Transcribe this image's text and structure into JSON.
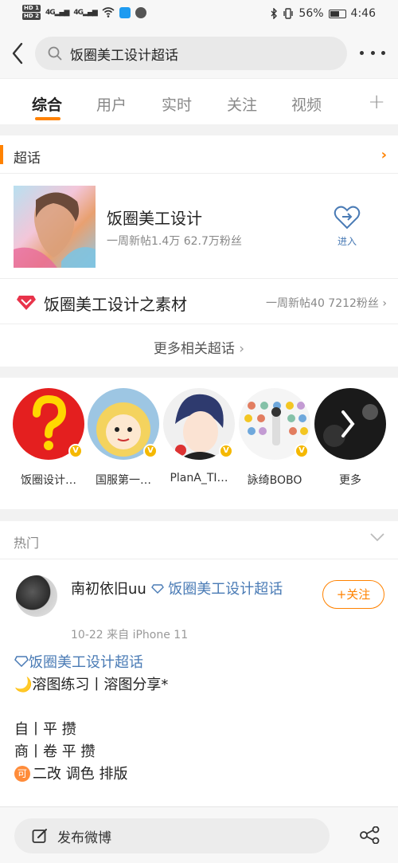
{
  "status_bar": {
    "hd1": "HD 1",
    "hd2": "HD 2",
    "signal1": "4G",
    "signal2": "4G",
    "battery_text": "56%",
    "time": "4:46"
  },
  "search": {
    "query": "饭圈美工设计超话"
  },
  "tabs": [
    {
      "label": "综合",
      "active": true
    },
    {
      "label": "用户",
      "active": false
    },
    {
      "label": "实时",
      "active": false
    },
    {
      "label": "关注",
      "active": false
    },
    {
      "label": "视频",
      "active": false
    }
  ],
  "tab_add": "+",
  "supertopic": {
    "section_title": "超话",
    "main": {
      "name": "饭圈美工设计",
      "stats": "一周新帖1.4万 62.7万粉丝",
      "enter_label": "进入"
    },
    "sub": {
      "name": "饭圈美工设计之素材",
      "stats": "一周新帖40 7212粉丝"
    },
    "more_label": "更多相关超话"
  },
  "users": [
    {
      "label": "饭圈设计…"
    },
    {
      "label": "国服第一…"
    },
    {
      "label": "PlanA_TI…"
    },
    {
      "label": "詠绮BOBO"
    },
    {
      "label": "更多"
    }
  ],
  "verified_badge": "V",
  "hot": {
    "title": "热门",
    "post": {
      "username": "南初依旧uu",
      "topic_tag": "饭圈美工设计超话",
      "meta": "10-22  来自 iPhone 11",
      "follow_label": "+关注",
      "topic_link": "饭圈美工设计超话",
      "line1": "溶图练习丨溶图分享*",
      "line2": "自丨平 攒",
      "line3": "商丨卷 平 攒",
      "badge": "可",
      "line4": "二改 调色 排版"
    }
  },
  "bottom": {
    "compose_label": "发布微博"
  },
  "colors": {
    "accent": "#ff8200",
    "link": "#4a7bb5",
    "verified": "#f5b800"
  }
}
